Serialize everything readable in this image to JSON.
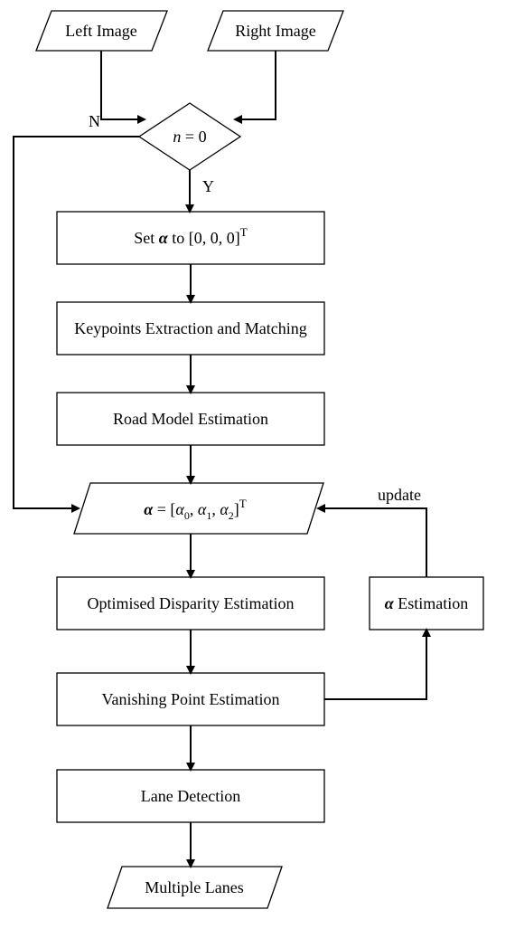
{
  "chart_data": {
    "type": "flowchart",
    "nodes": [
      {
        "id": "left_image",
        "shape": "parallelogram",
        "label": "Left Image"
      },
      {
        "id": "right_image",
        "shape": "parallelogram",
        "label": "Right Image"
      },
      {
        "id": "decision",
        "shape": "diamond",
        "label": "n = 0"
      },
      {
        "id": "set_alpha",
        "shape": "rect",
        "label": "Set α to [0, 0, 0]ᵀ"
      },
      {
        "id": "keypoints",
        "shape": "rect",
        "label": "Keypoints Extraction and Matching"
      },
      {
        "id": "road_model",
        "shape": "rect",
        "label": "Road Model Estimation"
      },
      {
        "id": "alpha_io",
        "shape": "parallelogram",
        "label": "α = [α₀, α₁, α₂]ᵀ"
      },
      {
        "id": "disparity",
        "shape": "rect",
        "label": "Optimised Disparity Estimation"
      },
      {
        "id": "vanishing",
        "shape": "rect",
        "label": "Vanishing Point Estimation"
      },
      {
        "id": "lane_detect",
        "shape": "rect",
        "label": "Lane Detection"
      },
      {
        "id": "multi_lanes",
        "shape": "parallelogram",
        "label": "Multiple Lanes"
      },
      {
        "id": "alpha_est",
        "shape": "rect",
        "label": "α Estimation"
      }
    ],
    "edges": [
      {
        "from": "left_image",
        "to": "decision"
      },
      {
        "from": "right_image",
        "to": "decision"
      },
      {
        "from": "decision",
        "to": "set_alpha",
        "label": "Y"
      },
      {
        "from": "decision",
        "to": "alpha_io",
        "label": "N"
      },
      {
        "from": "set_alpha",
        "to": "keypoints"
      },
      {
        "from": "keypoints",
        "to": "road_model"
      },
      {
        "from": "road_model",
        "to": "alpha_io"
      },
      {
        "from": "alpha_io",
        "to": "disparity"
      },
      {
        "from": "disparity",
        "to": "vanishing"
      },
      {
        "from": "vanishing",
        "to": "lane_detect"
      },
      {
        "from": "lane_detect",
        "to": "multi_lanes"
      },
      {
        "from": "vanishing",
        "to": "alpha_est"
      },
      {
        "from": "alpha_est",
        "to": "alpha_io",
        "label": "update"
      }
    ]
  },
  "labels": {
    "left_image": "Left Image",
    "right_image": "Right Image",
    "decision_lhs": "n",
    "decision_eq": " = 0",
    "set_alpha_pre": "Set  ",
    "set_alpha_sym": "α",
    "set_alpha_post": "  to  [0, 0, 0]",
    "set_alpha_T": "T",
    "keypoints": "Keypoints Extraction and Matching",
    "road_model": "Road Model Estimation",
    "alpha_sym": "α",
    "alpha_eq": " = [",
    "alpha_a0": "α",
    "alpha_s0": "0",
    "alpha_c1": ", ",
    "alpha_a1": "α",
    "alpha_s1": "1",
    "alpha_c2": ", ",
    "alpha_a2": "α",
    "alpha_s2": "2",
    "alpha_close": "]",
    "alpha_T": "T",
    "disparity": "Optimised Disparity Estimation",
    "vanishing": "Vanishing Point Estimation",
    "lane_detect": "Lane Detection",
    "multi_lanes": "Multiple Lanes",
    "alpha_est_sym": " Estimation",
    "edge_Y": "Y",
    "edge_N": "N",
    "edge_update": "update"
  }
}
